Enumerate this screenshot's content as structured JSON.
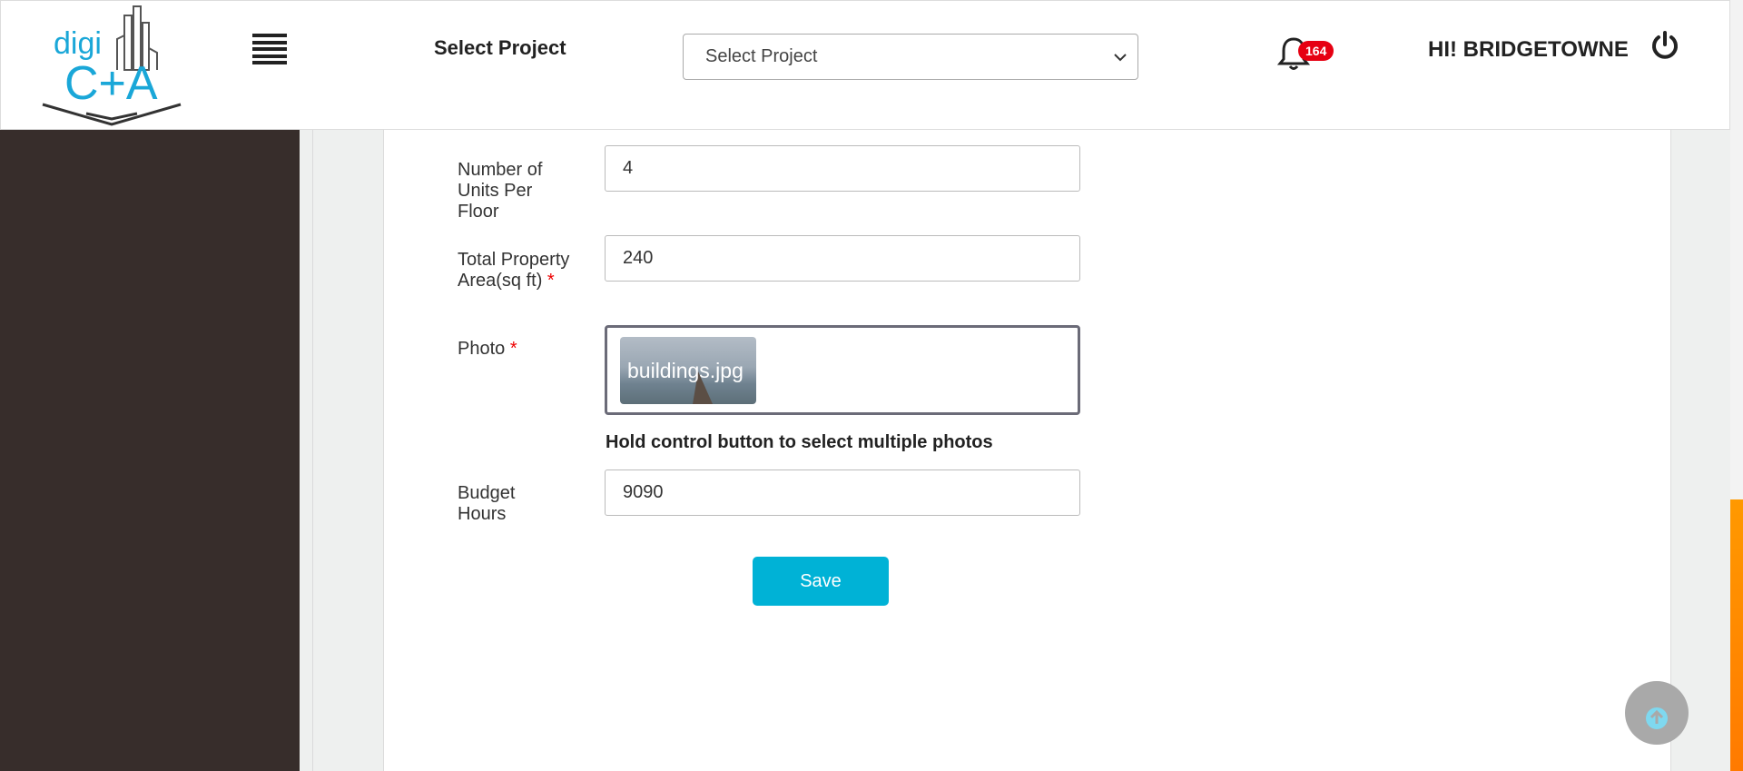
{
  "header": {
    "logo_text_top": "digi",
    "logo_text_bottom": "C+A",
    "menu_icon": "hamburger-icon",
    "select_label": "Select Project",
    "project_select": {
      "selected": "Select Project"
    },
    "notifications": {
      "icon": "bell-icon",
      "count": "164"
    },
    "greeting": "HI! BRIDGETOWNE",
    "logout_icon": "power-icon"
  },
  "form": {
    "units_per_floor": {
      "label": "Number of Units Per Floor",
      "value": "4"
    },
    "total_area": {
      "label": "Total Property Area(sq ft)",
      "required": "*",
      "value": "240"
    },
    "photo": {
      "label": "Photo",
      "required": "*",
      "file_name": "buildings.jpg",
      "hint": "Hold control button to select multiple photos"
    },
    "budget_hours": {
      "label": "Budget Hours",
      "value": "9090"
    },
    "save_label": "Save"
  },
  "scroll_top_icon": "arrow-up-circle-icon",
  "colors": {
    "accent": "#00b2d6",
    "sidebar": "#372d2b",
    "badge": "#e60012",
    "logo": "#1aa7d8"
  }
}
